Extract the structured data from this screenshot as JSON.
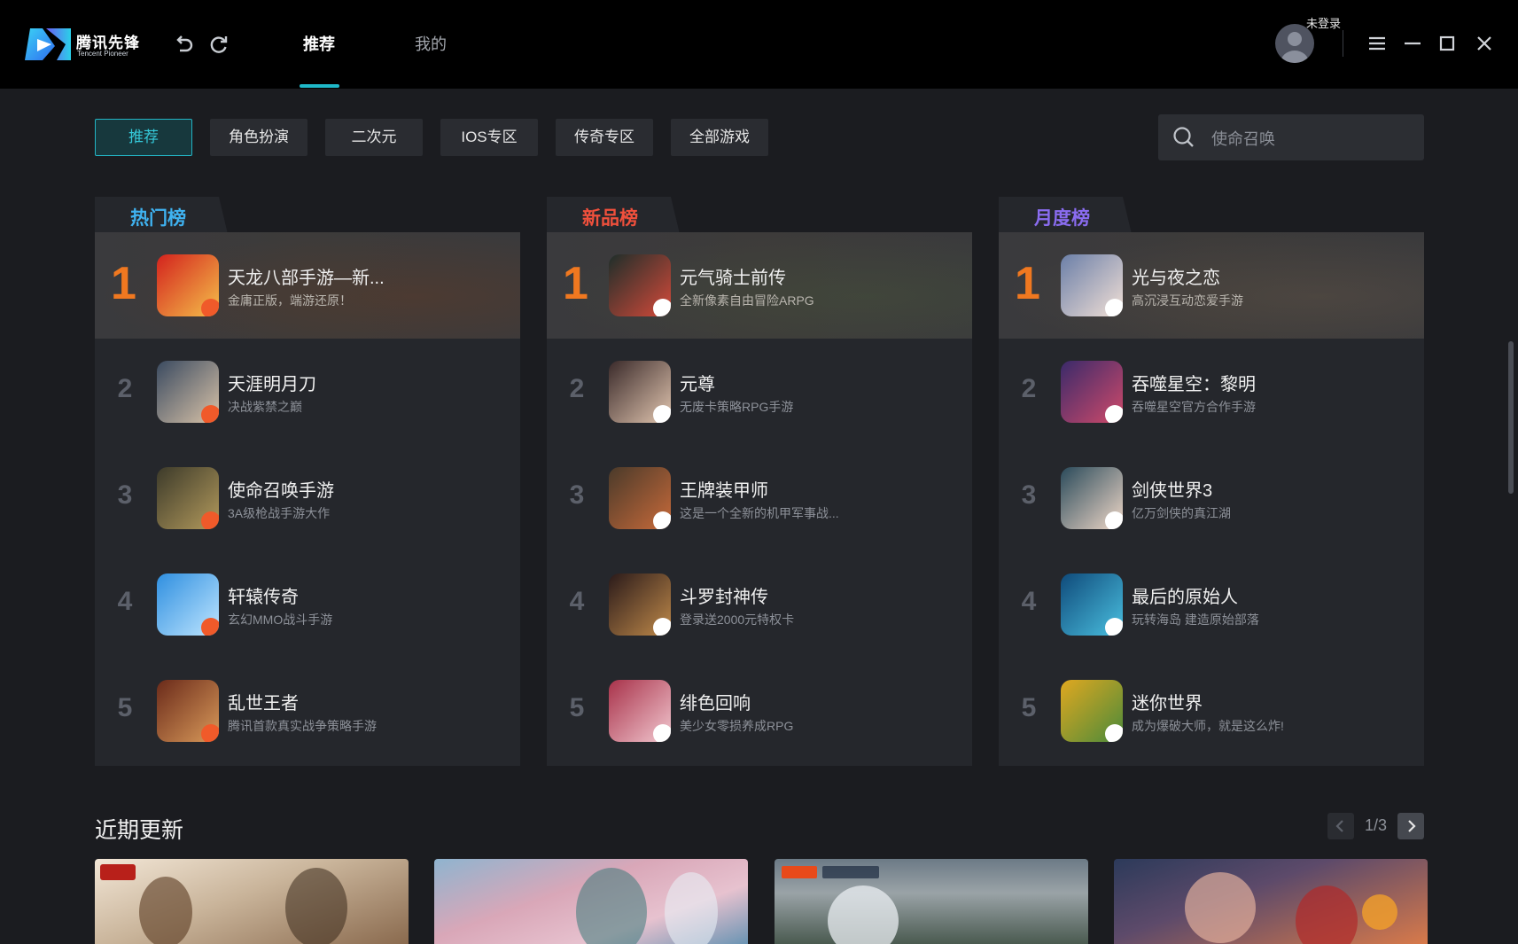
{
  "app": {
    "logo_cn": "腾讯先锋",
    "logo_en": "Tencent Pioneer",
    "tabs": [
      {
        "label": "推荐",
        "active": true
      },
      {
        "label": "我的",
        "active": false
      }
    ],
    "login_status": "未登录"
  },
  "filters": {
    "chips": [
      {
        "label": "推荐",
        "active": true
      },
      {
        "label": "角色扮演",
        "active": false
      },
      {
        "label": "二次元",
        "active": false
      },
      {
        "label": "IOS专区",
        "active": false
      },
      {
        "label": "传奇专区",
        "active": false
      },
      {
        "label": "全部游戏",
        "active": false
      }
    ],
    "search_placeholder": "使命召唤"
  },
  "rankings": [
    {
      "title": "热门榜",
      "title_color": "#3fb2f0",
      "games": [
        {
          "rank": "1",
          "name": "天龙八部手游—新...",
          "desc": "金庸正版，端游还原！"
        },
        {
          "rank": "2",
          "name": "天涯明月刀",
          "desc": "决战紫禁之巅"
        },
        {
          "rank": "3",
          "name": "使命召唤手游",
          "desc": "3A级枪战手游大作"
        },
        {
          "rank": "4",
          "name": "轩辕传奇",
          "desc": "玄幻MMO战斗手游"
        },
        {
          "rank": "5",
          "name": "乱世王者",
          "desc": "腾讯首款真实战争策略手游"
        }
      ]
    },
    {
      "title": "新品榜",
      "title_color": "#f0503c",
      "games": [
        {
          "rank": "1",
          "name": "元气骑士前传",
          "desc": "全新像素自由冒险ARPG"
        },
        {
          "rank": "2",
          "name": "元尊",
          "desc": "无废卡策略RPG手游"
        },
        {
          "rank": "3",
          "name": "王牌装甲师",
          "desc": "这是一个全新的机甲军事战..."
        },
        {
          "rank": "4",
          "name": "斗罗封神传",
          "desc": "登录送2000元特权卡"
        },
        {
          "rank": "5",
          "name": "绯色回响",
          "desc": "美少女零损养成RPG"
        }
      ]
    },
    {
      "title": "月度榜",
      "title_color": "#8a6cf0",
      "games": [
        {
          "rank": "1",
          "name": "光与夜之恋",
          "desc": "高沉浸互动恋爱手游"
        },
        {
          "rank": "2",
          "name": "吞噬星空：黎明",
          "desc": "吞噬星空官方合作手游"
        },
        {
          "rank": "3",
          "name": "剑侠世界3",
          "desc": "亿万剑侠的真江湖"
        },
        {
          "rank": "4",
          "name": "最后的原始人",
          "desc": "玩转海岛 建造原始部落"
        },
        {
          "rank": "5",
          "name": "迷你世界",
          "desc": "成为爆破大师，就是这么炸!"
        }
      ]
    }
  ],
  "recent": {
    "title": "近期更新",
    "pager": "1/3"
  }
}
